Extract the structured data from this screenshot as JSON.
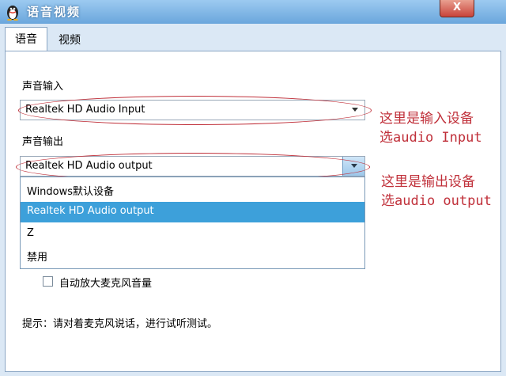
{
  "window": {
    "title": "语音视频",
    "close_label": "X"
  },
  "tabs": [
    {
      "label": "语音"
    },
    {
      "label": "视频"
    }
  ],
  "input": {
    "label": "声音输入",
    "value": "Realtek HD Audio Input"
  },
  "output": {
    "label": "声音输出",
    "value": "Realtek HD Audio output",
    "options": [
      {
        "label": "Windows默认设备"
      },
      {
        "label": "Realtek HD Audio output"
      },
      {
        "label": "Z"
      },
      {
        "label": "禁用"
      }
    ]
  },
  "auto_mic": {
    "label": "自动放大麦克风音量",
    "checked": false
  },
  "hint": "提示：请对着麦克风说话，进行试听测试。",
  "annotations": {
    "input_line1": "这里是输入设备",
    "input_line2": "选audio Input",
    "output_line1": "这里是输出设备",
    "output_line2": "选audio output"
  },
  "colors": {
    "annotation": "#c0303a",
    "selected": "#3da0da",
    "titlebar": "#7db2e3"
  }
}
